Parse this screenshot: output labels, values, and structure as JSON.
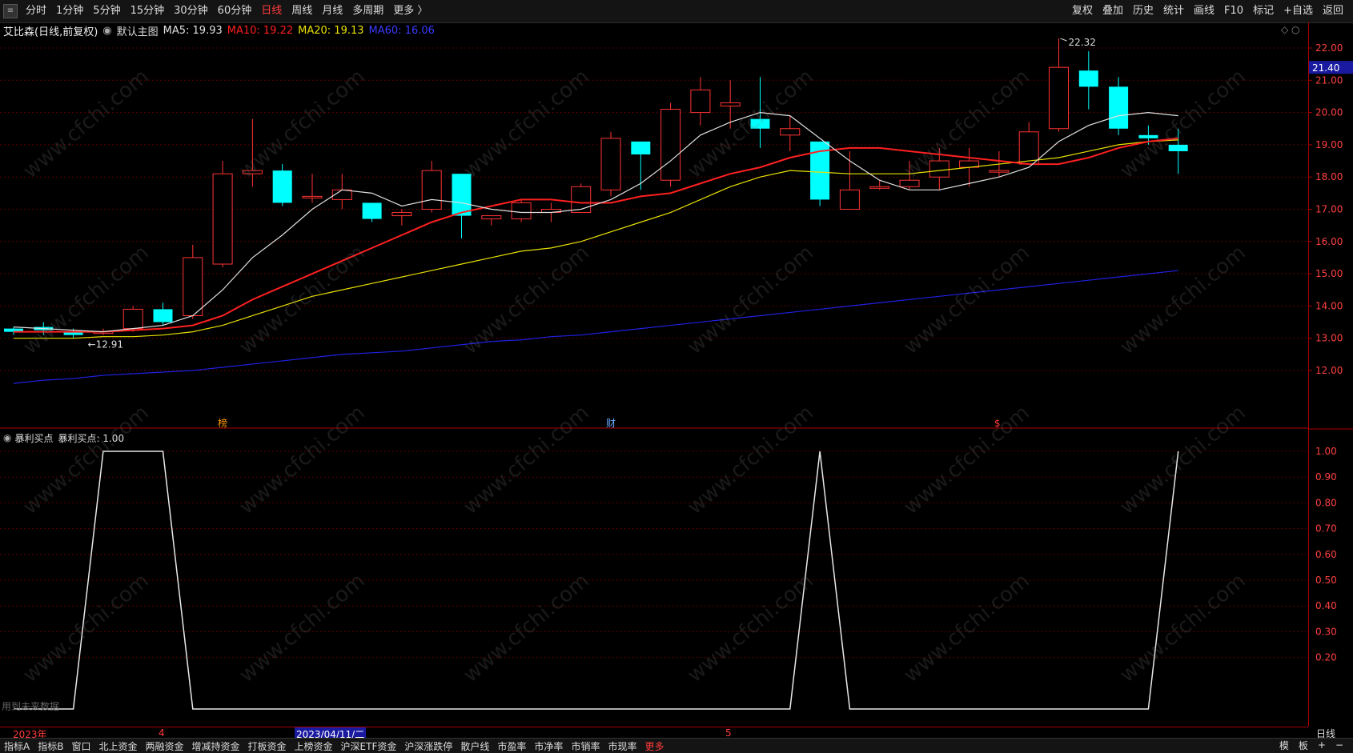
{
  "toolbar": {
    "periods": [
      "分时",
      "1分钟",
      "5分钟",
      "15分钟",
      "30分钟",
      "60分钟",
      "日线",
      "周线",
      "月线",
      "多周期",
      "更多 〉"
    ],
    "active_period": "日线",
    "right_tools": [
      "复权",
      "叠加",
      "历史",
      "统计",
      "画线",
      "F10",
      "标记",
      "+自选",
      "返回"
    ]
  },
  "info": {
    "stock": "艾比森(日线,前复权)",
    "main_chart": "默认主图",
    "ma5": "MA5: 19.93",
    "ma10": "MA10: 19.22",
    "ma20": "MA20: 19.13",
    "ma60": "MA60: 16.06"
  },
  "price_chart": {
    "ylabels": [
      "22.00",
      "21.00",
      "20.00",
      "19.00",
      "18.00",
      "17.00",
      "16.00",
      "15.00",
      "14.00",
      "13.00",
      "12.00"
    ],
    "current_price": "21.40",
    "high_label": "22.32",
    "low_label": "12.91",
    "markers": [
      "榜",
      "财",
      "$"
    ],
    "candles": [
      [
        13.3,
        13.2,
        13.35,
        13.1
      ],
      [
        13.35,
        13.25,
        13.5,
        13.1
      ],
      [
        13.2,
        13.1,
        13.3,
        13.0
      ],
      [
        13.15,
        13.2,
        13.3,
        13.1
      ],
      [
        13.3,
        13.9,
        14.0,
        13.2
      ],
      [
        13.9,
        13.5,
        14.1,
        13.4
      ],
      [
        13.7,
        15.5,
        15.9,
        13.6
      ],
      [
        15.3,
        18.1,
        18.5,
        15.2
      ],
      [
        18.1,
        18.2,
        19.8,
        17.7
      ],
      [
        18.2,
        17.2,
        18.4,
        17.1
      ],
      [
        17.4,
        17.4,
        18.1,
        17.2
      ],
      [
        17.3,
        17.6,
        18.1,
        17.0
      ],
      [
        17.2,
        16.7,
        17.2,
        16.6
      ],
      [
        16.8,
        16.9,
        17.0,
        16.5
      ],
      [
        17.0,
        18.2,
        18.5,
        16.9
      ],
      [
        18.1,
        16.8,
        18.1,
        16.1
      ],
      [
        16.7,
        16.8,
        16.8,
        16.5
      ],
      [
        16.7,
        17.2,
        17.3,
        16.6
      ],
      [
        16.9,
        17.0,
        17.2,
        16.6
      ],
      [
        16.9,
        17.7,
        17.8,
        16.9
      ],
      [
        17.6,
        19.2,
        19.4,
        17.4
      ],
      [
        19.1,
        18.7,
        19.1,
        17.6
      ],
      [
        17.9,
        20.1,
        20.3,
        17.7
      ],
      [
        20.0,
        20.7,
        21.1,
        19.6
      ],
      [
        20.2,
        20.3,
        21.0,
        19.5
      ],
      [
        19.8,
        19.5,
        21.1,
        18.9
      ],
      [
        19.3,
        19.5,
        19.9,
        18.8
      ],
      [
        19.1,
        17.3,
        19.1,
        17.1
      ],
      [
        17.0,
        17.6,
        18.8,
        17.0
      ],
      [
        17.7,
        17.7,
        17.9,
        17.6
      ],
      [
        17.7,
        17.9,
        18.5,
        17.6
      ],
      [
        18.0,
        18.5,
        18.9,
        17.6
      ],
      [
        18.3,
        18.5,
        18.9,
        17.7
      ],
      [
        18.2,
        18.2,
        18.8,
        18.0
      ],
      [
        18.4,
        19.4,
        19.7,
        18.4
      ],
      [
        19.5,
        21.4,
        22.3,
        19.4
      ],
      [
        21.3,
        20.8,
        21.9,
        20.1
      ],
      [
        20.8,
        19.5,
        21.1,
        19.3
      ],
      [
        19.3,
        19.2,
        19.6,
        19.0
      ],
      [
        19.0,
        18.8,
        19.5,
        18.1
      ]
    ],
    "ma5": [
      13.35,
      13.3,
      13.25,
      13.2,
      13.3,
      13.4,
      13.7,
      14.5,
      15.5,
      16.2,
      17.0,
      17.6,
      17.5,
      17.1,
      17.3,
      17.2,
      17.0,
      16.9,
      16.9,
      17.0,
      17.3,
      17.8,
      18.5,
      19.3,
      19.7,
      20.0,
      19.9,
      19.2,
      18.5,
      17.9,
      17.6,
      17.6,
      17.8,
      18.0,
      18.3,
      19.1,
      19.6,
      19.9,
      20.0,
      19.9
    ],
    "ma10": [
      13.2,
      13.2,
      13.2,
      13.2,
      13.25,
      13.3,
      13.4,
      13.7,
      14.2,
      14.6,
      15.0,
      15.4,
      15.8,
      16.2,
      16.6,
      16.9,
      17.1,
      17.3,
      17.3,
      17.2,
      17.2,
      17.4,
      17.5,
      17.8,
      18.1,
      18.3,
      18.6,
      18.8,
      18.9,
      18.9,
      18.8,
      18.7,
      18.6,
      18.5,
      18.4,
      18.4,
      18.6,
      18.9,
      19.1,
      19.2
    ],
    "ma20": [
      13.0,
      13.0,
      13.0,
      13.05,
      13.05,
      13.1,
      13.2,
      13.4,
      13.7,
      14.0,
      14.3,
      14.5,
      14.7,
      14.9,
      15.1,
      15.3,
      15.5,
      15.7,
      15.8,
      16.0,
      16.3,
      16.6,
      16.9,
      17.3,
      17.7,
      18.0,
      18.2,
      18.15,
      18.1,
      18.1,
      18.1,
      18.2,
      18.3,
      18.4,
      18.5,
      18.6,
      18.8,
      19.0,
      19.1,
      19.15
    ],
    "ma60": [
      11.6,
      11.7,
      11.75,
      11.85,
      11.9,
      11.95,
      12.0,
      12.1,
      12.2,
      12.3,
      12.4,
      12.5,
      12.55,
      12.6,
      12.7,
      12.8,
      12.9,
      12.95,
      13.05,
      13.1,
      13.2,
      13.3,
      13.4,
      13.5,
      13.6,
      13.7,
      13.8,
      13.9,
      14.0,
      14.1,
      14.2,
      14.3,
      14.4,
      14.5,
      14.6,
      14.7,
      14.8,
      14.9,
      15.0,
      15.1
    ]
  },
  "indicator": {
    "name": "暴利买点",
    "value_label": "暴利买点: 1.00",
    "ylabels": [
      "1.00",
      "0.90",
      "0.80",
      "0.70",
      "0.60",
      "0.50",
      "0.40",
      "0.30",
      "0.20"
    ],
    "values": [
      0,
      0,
      0,
      1,
      1,
      1,
      0,
      0,
      0,
      0,
      0,
      0,
      0,
      0,
      0,
      0,
      0,
      0,
      0,
      0,
      0,
      0,
      0,
      0,
      0,
      0,
      0,
      1,
      0,
      0,
      0,
      0,
      0,
      0,
      0,
      0,
      0,
      0,
      0,
      1
    ],
    "note": "用到未来数据"
  },
  "date_axis": {
    "labels": [
      "2023年",
      "4",
      "2023/04/11/二",
      "5"
    ],
    "right_label": "日线"
  },
  "bottom": {
    "tabs": [
      "指标A",
      "指标B",
      "窗口",
      "北上资金",
      "两融资金",
      "增减持资金",
      "打板资金",
      "上榜资金",
      "沪深ETF资金",
      "沪深涨跌停",
      "散户线",
      "市盈率",
      "市净率",
      "市销率",
      "市现率",
      "更多"
    ],
    "right": [
      "模",
      "板",
      "+",
      "−"
    ]
  },
  "colors": {
    "up": "#ff3333",
    "down": "#00ffff",
    "ma5": "#e0e0e0",
    "ma10": "#ff2020",
    "ma20": "#e8e000",
    "ma60": "#2020e0"
  },
  "watermark": "www.cfchi.com"
}
